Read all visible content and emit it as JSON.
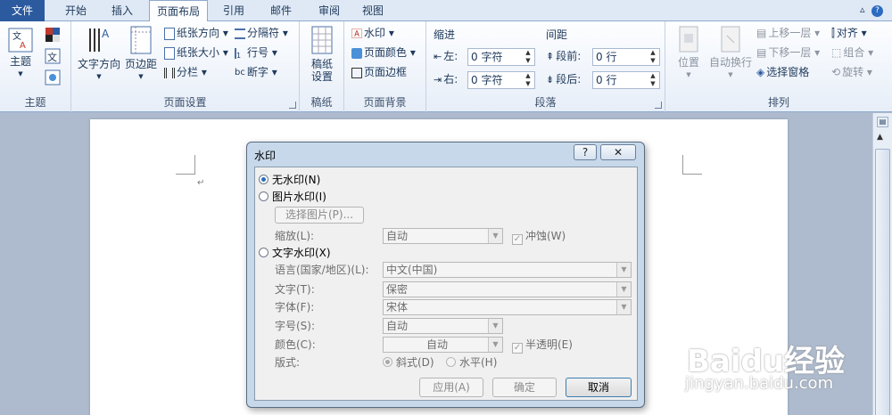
{
  "tabs": {
    "file": "文件",
    "home": "开始",
    "insert": "插入",
    "page_layout": "页面布局",
    "references": "引用",
    "mailings": "邮件",
    "review": "审阅",
    "view": "视图"
  },
  "ribbon": {
    "themes": {
      "themes_label": "主题",
      "group_label": "主题"
    },
    "page_setup": {
      "text_direction": "文字方向",
      "margins": "页边距",
      "orientation": "纸张方向",
      "size": "纸张大小",
      "columns": "分栏",
      "breaks": "分隔符",
      "line_numbers": "行号",
      "hyphenation": "断字",
      "group_label": "页面设置"
    },
    "manuscript": {
      "label_line1": "稿纸",
      "label_line2": "设置",
      "group_label": "稿纸"
    },
    "page_background": {
      "watermark": "水印",
      "page_color": "页面颜色",
      "page_borders": "页面边框",
      "group_label": "页面背景"
    },
    "paragraph": {
      "indent_title": "缩进",
      "left_label": "左:",
      "left_value": "0 字符",
      "right_label": "右:",
      "right_value": "0 字符",
      "spacing_title": "间距",
      "before_label": "段前:",
      "before_value": "0 行",
      "after_label": "段后:",
      "after_value": "0 行",
      "group_label": "段落"
    },
    "arrange": {
      "position": "位置",
      "wrap_text": "自动换行",
      "bring_forward": "上移一层",
      "send_backward": "下移一层",
      "selection_pane": "选择窗格",
      "align": "对齐",
      "group": "组合",
      "rotate": "旋转",
      "group_label": "排列"
    }
  },
  "dialog": {
    "title": "水印",
    "help": "?",
    "close": "✕",
    "no_watermark": "无水印(N)",
    "picture_watermark": "图片水印(I)",
    "select_picture": "选择图片(P)...",
    "scale_label": "缩放(L):",
    "scale_value": "自动",
    "washout": "冲蚀(W)",
    "text_watermark": "文字水印(X)",
    "language_label": "语言(国家/地区)(L):",
    "language_value": "中文(中国)",
    "text_label": "文字(T):",
    "text_value": "保密",
    "font_label": "字体(F):",
    "font_value": "宋体",
    "size_label": "字号(S):",
    "size_value": "自动",
    "color_label": "颜色(C):",
    "color_value": "自动",
    "semitransparent": "半透明(E)",
    "layout_label": "版式:",
    "diagonal": "斜式(D)",
    "horizontal": "水平(H)",
    "apply": "应用(A)",
    "ok": "确定",
    "cancel": "取消"
  },
  "watermark": {
    "brand": "Baidu经验",
    "url": "jingyan.baidu.com"
  },
  "colors": {
    "file_tab": "#2c5a9e",
    "ribbon_border": "#8ea9cf",
    "dialog_frame": "#c7d8ea"
  }
}
